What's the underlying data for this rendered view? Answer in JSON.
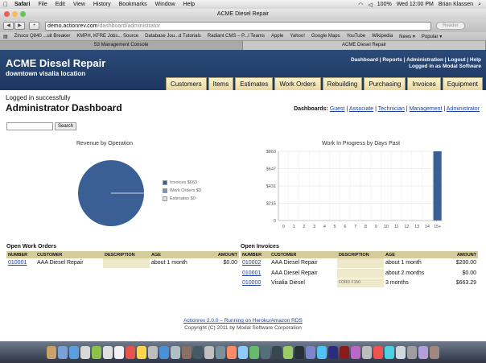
{
  "menubar": {
    "items": [
      "Safari",
      "File",
      "Edit",
      "View",
      "History",
      "Bookmarks",
      "Window",
      "Help"
    ],
    "status": {
      "battery": "100%",
      "clock": "Wed 12:00 PM",
      "user": "Brian Klassen"
    }
  },
  "window": {
    "title": "ACME Diesel Repair"
  },
  "toolbar": {
    "url_host": "demo.actionrev.com",
    "url_path": "/dashboard/administrator",
    "reader_label": "Reader",
    "back": "◀",
    "forward": "▶",
    "share": "+"
  },
  "bookmarks": [
    "Zinsco Q840 ...uit Breaker",
    "KMPH, KFRE Jobs... Source",
    "Database Jou...d Tutorials",
    "Radiant CMS – P...l Teams",
    "Apple",
    "Yahoo!",
    "Google Maps",
    "YouTube",
    "Wikipedia",
    "News ▾",
    "Popular ▾"
  ],
  "browser_tabs": [
    {
      "label": "S3 Management Console",
      "active": false
    },
    {
      "label": "ACME Diesel Repair",
      "active": true
    }
  ],
  "site": {
    "brand": "ACME Diesel Repair",
    "location": "downtown visalia location",
    "toplinks": [
      "Dashboard",
      "Reports",
      "Administration",
      "Logout",
      "Help"
    ],
    "logged_in_as": "Logged in as Modal Software",
    "nav": [
      "Customers",
      "Items",
      "Estimates",
      "Work Orders",
      "Rebuilding",
      "Purchasing",
      "Invoices",
      "Equipment"
    ]
  },
  "page": {
    "flash": "Logged in successfully",
    "title": "Administrator Dashboard",
    "dashboards_label": "Dashboards:",
    "dashboards": [
      "Guest",
      "Associate",
      "Technician",
      "Management",
      "Administrator"
    ],
    "search_button": "Search",
    "search_value": ""
  },
  "chart_data": [
    {
      "type": "pie",
      "title": "Revenue by Operation",
      "labels": [
        "Invoices $663",
        "Work Orders $0",
        "Estimates $0"
      ],
      "values": [
        663,
        0,
        0
      ],
      "colors": [
        "#3a5f95",
        "#7d93b5",
        "#dde2ec"
      ]
    },
    {
      "type": "bar",
      "title": "Work In Progress by Days Past",
      "categories": [
        "0",
        "1",
        "2",
        "3",
        "4",
        "5",
        "6",
        "7",
        "8",
        "9",
        "10",
        "11",
        "12",
        "13",
        "14",
        "15+"
      ],
      "values": [
        0,
        0,
        0,
        0,
        0,
        0,
        0,
        0,
        0,
        0,
        0,
        0,
        0,
        0,
        0,
        863
      ],
      "yticks": [
        "0",
        "$215",
        "$431",
        "$647",
        "$863"
      ],
      "ylim": [
        0,
        863
      ],
      "color": "#3a5f95",
      "grid": true
    }
  ],
  "open_work_orders": {
    "title": "Open Work Orders",
    "columns": [
      "NUMBER",
      "CUSTOMER",
      "DESCRIPTION",
      "AGE",
      "AMOUNT"
    ],
    "rows": [
      {
        "number": "010001",
        "customer": "AAA Diesel Repair",
        "description": "",
        "age": "about 1 month",
        "amount": "$0.00"
      }
    ]
  },
  "open_invoices": {
    "title": "Open Invoices",
    "columns": [
      "NUMBER",
      "CUSTOMER",
      "DESCRIPTION",
      "AGE",
      "AMOUNT"
    ],
    "rows": [
      {
        "number": "010002",
        "customer": "AAA Diesel Repair",
        "description": "",
        "age": "about 1 month",
        "amount": "$200.00"
      },
      {
        "number": "010001",
        "customer": "AAA Diesel Repair",
        "description": "",
        "age": "about 2 months",
        "amount": "$0.00"
      },
      {
        "number": "010000",
        "customer": "Visalia Diesel",
        "description": "FORD F150",
        "age": "3 months",
        "amount": "$663.29"
      }
    ]
  },
  "footer": {
    "line1": "Actionrev 2.0.0 – Running on Heroku/Amazon RDS",
    "line2": "Copyright (C) 2011 by Modal Software Corporation"
  },
  "dock_colors": [
    "#c9a26b",
    "#7aa0d8",
    "#5aa0e0",
    "#d8d8d8",
    "#8bc34a",
    "#e0e0e0",
    "#f2f2f2",
    "#e5534b",
    "#ffd54f",
    "#bdbdbd",
    "#4a90d9",
    "#b0bec5",
    "#8d6e63",
    "#455a64",
    "#c0c0c0",
    "#78909c",
    "#ff8a65",
    "#90caf9",
    "#66bb6a",
    "#546e7a",
    "#37474f",
    "#9ccc65",
    "#263238",
    "#7986cb",
    "#4fc3f7",
    "#2b2b80",
    "#8b1a1a",
    "#ba68c8",
    "#bdbdbd",
    "#ef5350",
    "#4dd0e1",
    "#cfd8dc",
    "#9e9e9e",
    "#b39ddb",
    "#a1887f"
  ]
}
